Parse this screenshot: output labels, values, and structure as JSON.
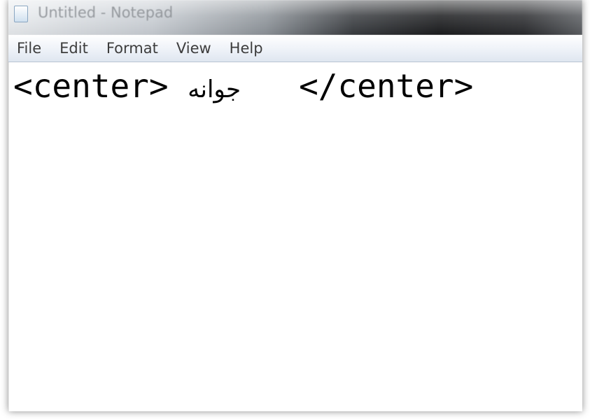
{
  "window": {
    "title": "Untitled - Notepad"
  },
  "menubar": {
    "items": [
      {
        "label": "File"
      },
      {
        "label": "Edit"
      },
      {
        "label": "Format"
      },
      {
        "label": "View"
      },
      {
        "label": "Help"
      }
    ]
  },
  "editor": {
    "open_tag": "<center> ",
    "arabic_word": "جوانه",
    "close_tag": "   </center>"
  },
  "colors": {
    "menubar_bg": "#eef2f8",
    "text": "#000000"
  },
  "icons": {
    "app_icon": "notepad-icon"
  }
}
